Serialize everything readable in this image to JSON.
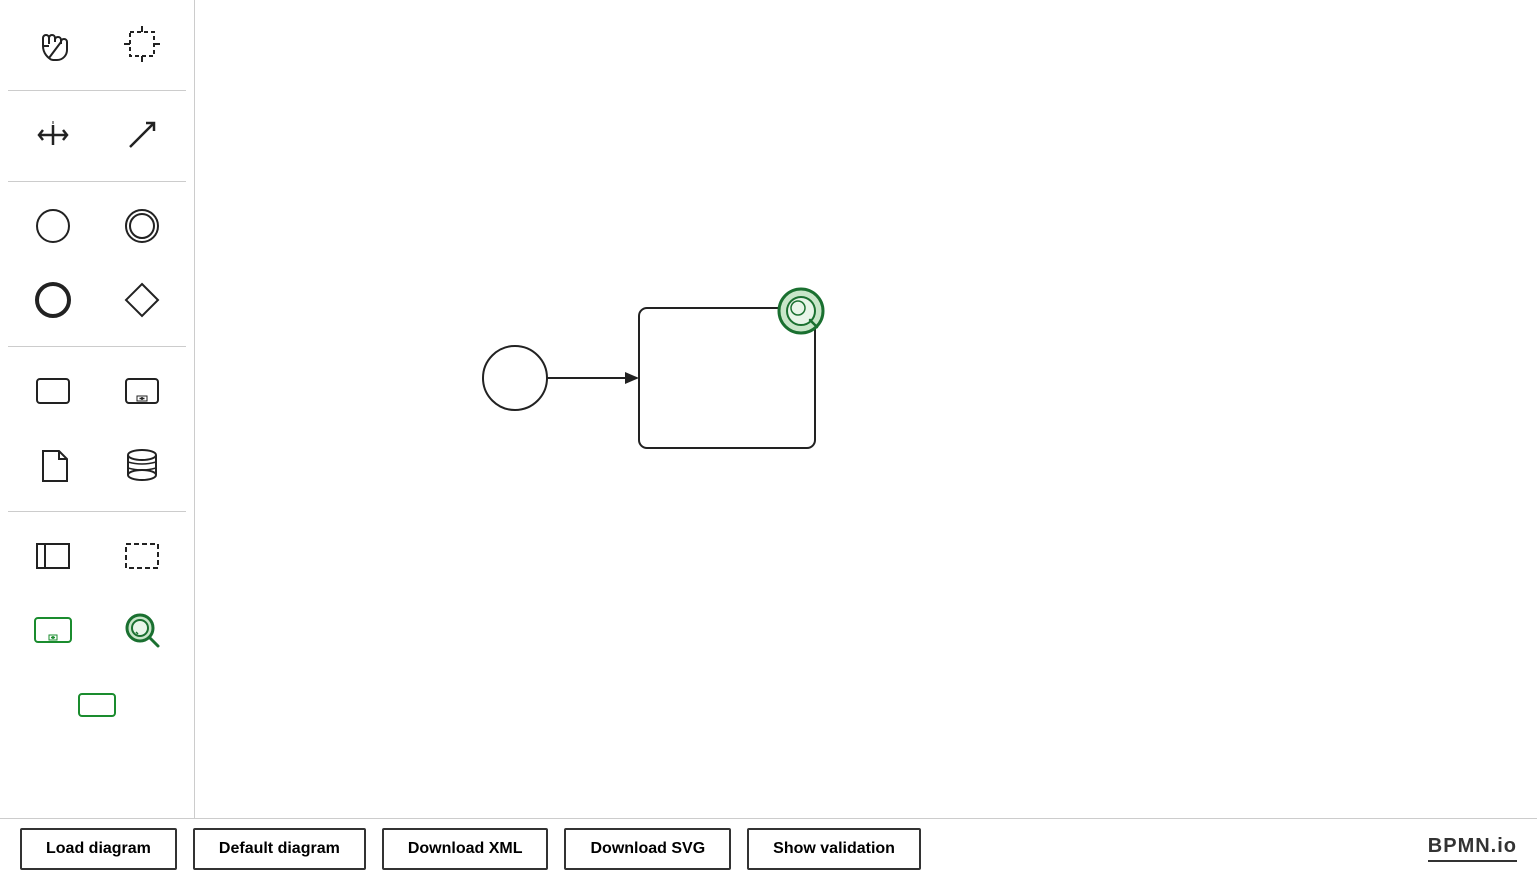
{
  "toolbar": {
    "tools": [
      {
        "id": "hand",
        "label": "Hand tool",
        "icon": "hand"
      },
      {
        "id": "select",
        "label": "Select tool",
        "icon": "crosshair-select"
      },
      {
        "id": "connect-hv",
        "label": "Connect horizontal/vertical",
        "icon": "arrows-hv"
      },
      {
        "id": "connect-diag",
        "label": "Connect diagonal",
        "icon": "arrow-diagonal"
      },
      {
        "id": "start-event",
        "label": "Start Event",
        "icon": "circle-thin"
      },
      {
        "id": "intermediate-event",
        "label": "Intermediate Event",
        "icon": "circle-double"
      },
      {
        "id": "end-event",
        "label": "End Event",
        "icon": "circle-thick"
      },
      {
        "id": "gateway",
        "label": "Gateway",
        "icon": "diamond"
      },
      {
        "id": "task",
        "label": "Task",
        "icon": "rect-rounded"
      },
      {
        "id": "subprocess",
        "label": "Sub-process",
        "icon": "rect-plus"
      },
      {
        "id": "data-object",
        "label": "Data Object",
        "icon": "document"
      },
      {
        "id": "data-store",
        "label": "Data Store",
        "icon": "cylinder"
      },
      {
        "id": "pool",
        "label": "Pool",
        "icon": "rect-pool"
      },
      {
        "id": "lane",
        "label": "Lane",
        "icon": "rect-dashed"
      },
      {
        "id": "expand-subprocess",
        "label": "Expand Sub-process",
        "icon": "rect-green-expand"
      },
      {
        "id": "find",
        "label": "Find",
        "icon": "magnifier-green"
      },
      {
        "id": "group",
        "label": "Group",
        "icon": "rect-green-small"
      }
    ]
  },
  "bottom_bar": {
    "buttons": [
      {
        "id": "load-diagram",
        "label": "Load diagram"
      },
      {
        "id": "default-diagram",
        "label": "Default diagram"
      },
      {
        "id": "download-xml",
        "label": "Download XML"
      },
      {
        "id": "download-svg",
        "label": "Download SVG"
      },
      {
        "id": "show-validation",
        "label": "Show validation"
      }
    ],
    "logo": "BPMN.io"
  },
  "canvas": {
    "diagram_present": true
  }
}
